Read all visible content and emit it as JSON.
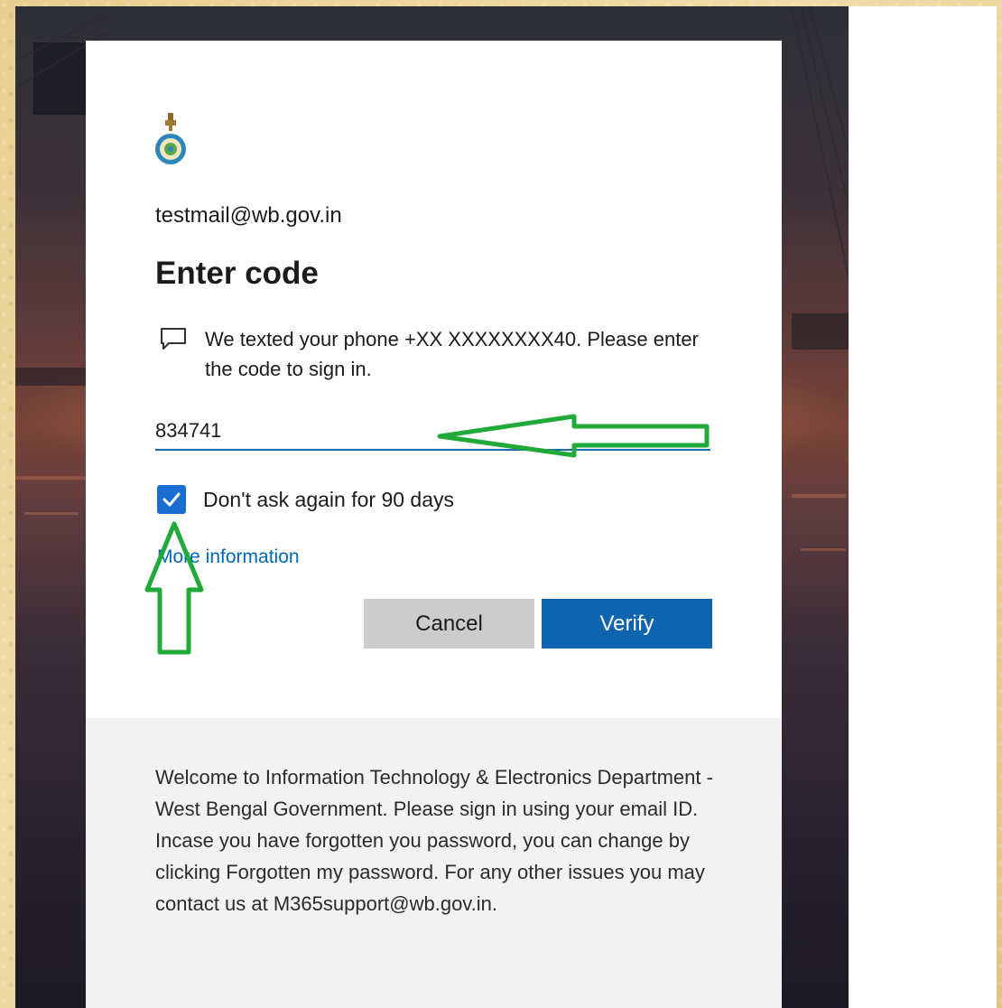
{
  "account": {
    "email": "testmail@wb.gov.in"
  },
  "dialog": {
    "title": "Enter code",
    "message": "We texted your phone +XX XXXXXXXX40. Please enter the code to sign in.",
    "code_value": "834741",
    "remember_label": "Don't ask again for 90 days",
    "remember_checked": true,
    "more_info_label": "More information",
    "cancel_label": "Cancel",
    "verify_label": "Verify"
  },
  "footer": {
    "text": "Welcome to Information Technology & Electronics Department - West Bengal Government. Please sign in using your email ID. Incase you have forgotten you password, you can change by clicking Forgotten my password. For any other issues you may contact us at M365support@wb.gov.in."
  },
  "colors": {
    "accent": "#0f64b0",
    "checkbox": "#1a6ed0",
    "link": "#0067b8",
    "annotation": "#1faa3a"
  },
  "icons": {
    "logo": "west-bengal-emblem",
    "message": "chat-bubble-icon",
    "check": "checkmark-icon"
  }
}
